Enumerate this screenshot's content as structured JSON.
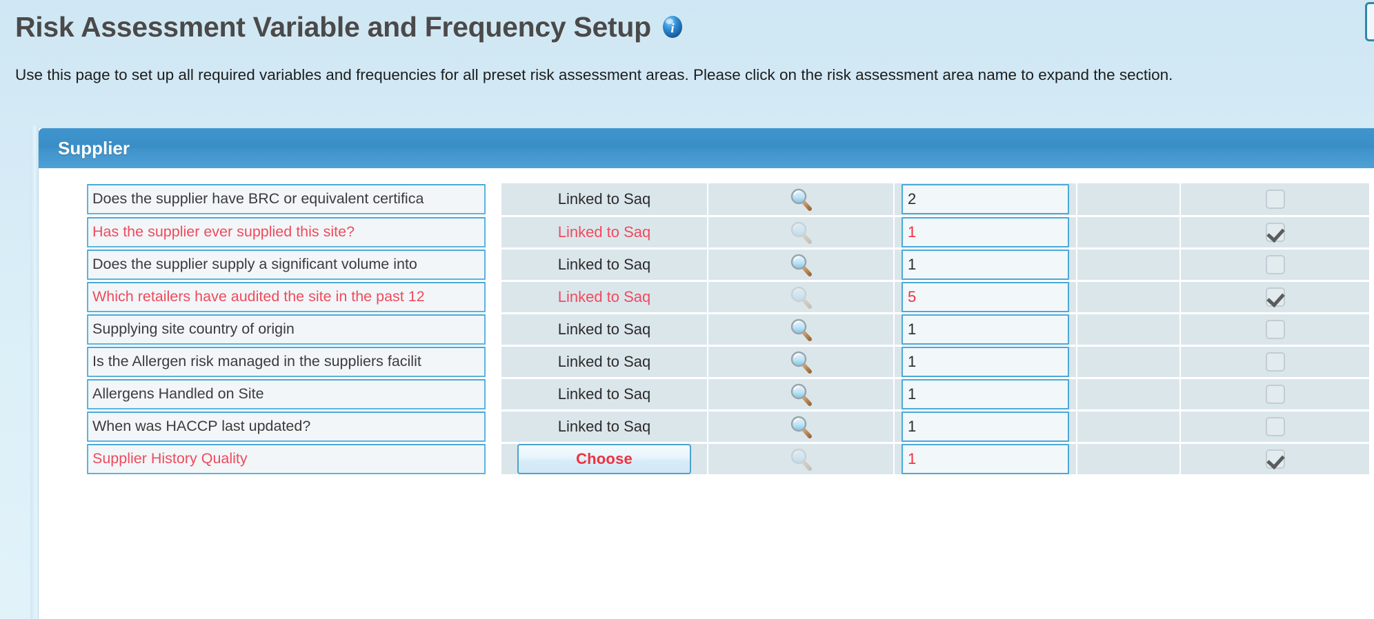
{
  "header": {
    "title": "Risk Assessment Variable and Frequency Setup",
    "info_icon": "info-icon",
    "description": "Use this page to set up all required variables and frequencies for all preset risk assessment areas. Please click on the risk assessment area name to expand the section."
  },
  "colors": {
    "panel_header_blue": "#3f93cb",
    "red_text": "#f04a5c",
    "input_border_blue": "#4aa9d8",
    "page_bg": "#d6ebf6",
    "cell_bg": "#dbe6eb"
  },
  "section": {
    "name": "Supplier",
    "expanded": true
  },
  "rows": [
    {
      "variable": "Does the supplier have BRC or equivalent certifica",
      "variable_red": false,
      "link_label": "Linked to Saq",
      "link_is_button": false,
      "link_red": false,
      "magnifier": "search-icon",
      "magnifier_faded": false,
      "frequency": "2",
      "frequency_red": false,
      "checked": false
    },
    {
      "variable": "Has the supplier ever supplied this site?",
      "variable_red": true,
      "link_label": "Linked to Saq",
      "link_is_button": false,
      "link_red": true,
      "magnifier": "search-icon",
      "magnifier_faded": true,
      "frequency": "1",
      "frequency_red": true,
      "checked": true
    },
    {
      "variable": "Does the supplier supply a significant volume into",
      "variable_red": false,
      "link_label": "Linked to Saq",
      "link_is_button": false,
      "link_red": false,
      "magnifier": "search-icon",
      "magnifier_faded": false,
      "frequency": "1",
      "frequency_red": false,
      "checked": false
    },
    {
      "variable": "Which retailers have audited the site in the past 12",
      "variable_red": true,
      "link_label": "Linked to Saq",
      "link_is_button": false,
      "link_red": true,
      "magnifier": "search-icon",
      "magnifier_faded": true,
      "frequency": "5",
      "frequency_red": true,
      "checked": true
    },
    {
      "variable": "Supplying site country of origin",
      "variable_red": false,
      "link_label": "Linked to Saq",
      "link_is_button": false,
      "link_red": false,
      "magnifier": "search-icon",
      "magnifier_faded": false,
      "frequency": "1",
      "frequency_red": false,
      "checked": false
    },
    {
      "variable": "Is the Allergen risk managed in the suppliers facilit",
      "variable_red": false,
      "link_label": "Linked to Saq",
      "link_is_button": false,
      "link_red": false,
      "magnifier": "search-icon",
      "magnifier_faded": false,
      "frequency": "1",
      "frequency_red": false,
      "checked": false
    },
    {
      "variable": "Allergens Handled on Site",
      "variable_red": false,
      "link_label": "Linked to Saq",
      "link_is_button": false,
      "link_red": false,
      "magnifier": "search-icon",
      "magnifier_faded": false,
      "frequency": "1",
      "frequency_red": false,
      "checked": false
    },
    {
      "variable": "When was HACCP last updated?",
      "variable_red": false,
      "link_label": "Linked to Saq",
      "link_is_button": false,
      "link_red": false,
      "magnifier": "search-icon",
      "magnifier_faded": false,
      "frequency": "1",
      "frequency_red": false,
      "checked": false
    },
    {
      "variable": "Supplier History Quality",
      "variable_red": true,
      "link_label": "Choose",
      "link_is_button": true,
      "link_red": true,
      "magnifier": "search-icon",
      "magnifier_faded": true,
      "frequency": "1",
      "frequency_red": true,
      "checked": true
    }
  ]
}
